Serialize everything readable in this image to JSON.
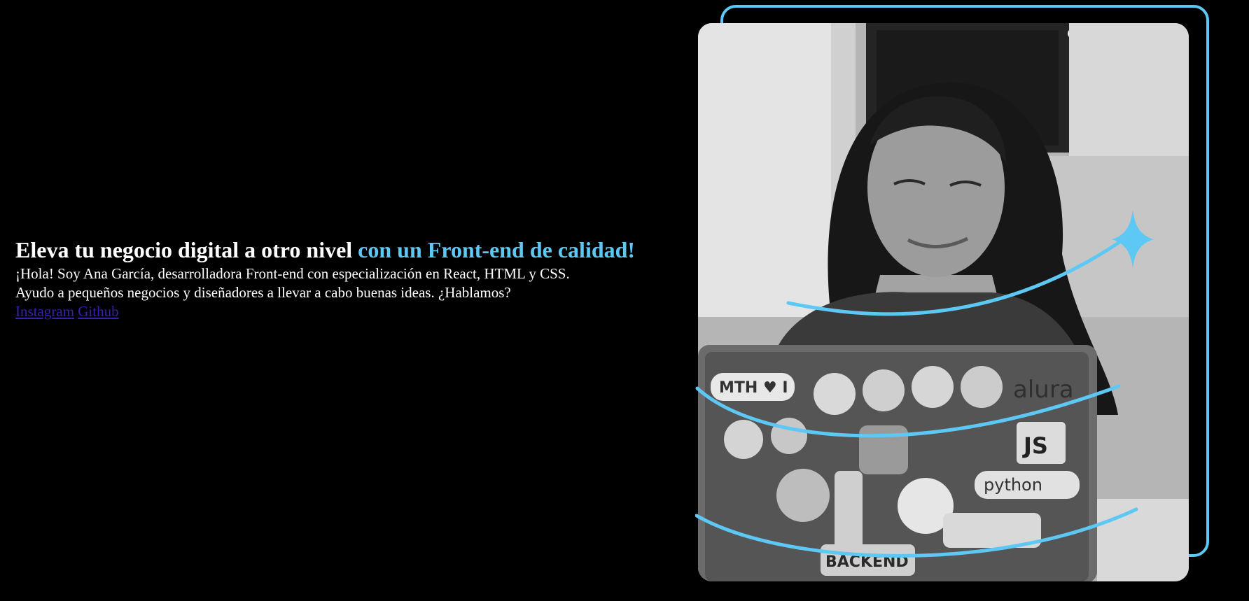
{
  "hero": {
    "headline_main": "Eleva tu negocio digital a otro nivel",
    "headline_accent": "con un Front-end de calidad!",
    "intro": "¡Hola! Soy Ana García, desarrolladora Front-end con especialización en React, HTML y CSS.\nAyudo a pequeños negocios y diseñadores a llevar a cabo buenas ideas. ¿Hablamos?",
    "links": [
      {
        "label": "Instagram"
      },
      {
        "label": "Github"
      }
    ]
  },
  "image": {
    "icons": [
      "sparkle-icon"
    ],
    "sticker_texts": [
      "MTH ♥ I",
      "alura",
      "JS",
      "python",
      "BACKEND"
    ]
  },
  "colors": {
    "background": "#000000",
    "accent": "#5ec8f5",
    "link": "#3b1fb0",
    "text": "#ffffff"
  }
}
